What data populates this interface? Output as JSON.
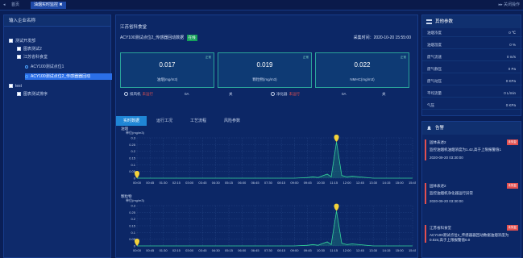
{
  "topbar": {
    "home_label": "首页",
    "active_tab": "油烟实时监控",
    "close_all": "关闭操作"
  },
  "tree": {
    "header": "输入企业名称",
    "nodes": [
      {
        "label": "测试开发部",
        "kind": "box",
        "level": 0
      },
      {
        "label": "图表测试2",
        "kind": "box",
        "level": 1
      },
      {
        "label": "江苏省科食堂",
        "kind": "box",
        "level": 1
      },
      {
        "label": "ACY100测试点位1",
        "kind": "dot",
        "level": 2
      },
      {
        "label": "ACY100测试点位2_传感器器回动",
        "kind": "dot",
        "level": 2,
        "selected": true
      },
      {
        "label": "test",
        "kind": "box",
        "level": 0
      },
      {
        "label": "图表测试排序",
        "kind": "box",
        "level": 1
      }
    ]
  },
  "main": {
    "restaurant": "江苏省科食堂",
    "device": "ACY100测试点位2_传感器回动数据",
    "online": "在线",
    "collect_time": "采集时间：2020-10-20 15:55:00",
    "cards": [
      {
        "value": "0.017",
        "label": "油烟(mg/m3)",
        "tag": "正常"
      },
      {
        "value": "0.019",
        "label": "颗粒物(mg/m3)",
        "tag": "正常"
      },
      {
        "value": "0.022",
        "label": "NMHC(mg/m3)",
        "tag": "正常"
      }
    ],
    "status": [
      {
        "name": "排风机",
        "state": "未运行",
        "current": "0A",
        "power": "关"
      },
      {
        "name": "净化器",
        "state": "未运行",
        "current": "0A",
        "power": "关"
      }
    ],
    "tabs": [
      "实时数据",
      "运行工况",
      "工艺流程",
      "风险参数"
    ]
  },
  "chart_data": [
    {
      "type": "line",
      "title": "油烟",
      "ylabel": "单位(mg/m3)",
      "ylim": [
        0,
        0.3
      ],
      "yticks": [
        "0.3",
        "0.25",
        "0.2",
        "0.15",
        "0.1",
        "0.05",
        "0"
      ],
      "x": [
        "00:00",
        "00:45",
        "01:30",
        "02:15",
        "03:00",
        "03:45",
        "04:30",
        "05:15",
        "06:00",
        "06:45",
        "07:30",
        "08:15",
        "09:00",
        "09:45",
        "10:30",
        "11:15",
        "12:00",
        "12:45",
        "13:30",
        "14:15",
        "15:00",
        "15:45"
      ],
      "values": [
        0,
        0,
        0,
        0,
        0,
        0,
        0,
        0,
        0,
        0,
        0,
        0,
        0,
        0.005,
        0.01,
        0.005,
        0.02,
        0.03,
        0.01,
        0.27,
        0.02,
        0.01,
        0.015,
        0,
        0,
        0
      ],
      "x_points": [
        0,
        1,
        2,
        3,
        4,
        5,
        6,
        7,
        8,
        9,
        10,
        11,
        12,
        13,
        13.4,
        13.8,
        14.2,
        14.5,
        14.8,
        15.2,
        15.6,
        16.0,
        16.4,
        18,
        20,
        21
      ]
    },
    {
      "type": "line",
      "title": "颗粒物",
      "ylabel": "单位(mg/m3)",
      "ylim": [
        0,
        0.3
      ],
      "yticks": [
        "0.3",
        "0.25",
        "0.2",
        "0.15",
        "0.1",
        "0.05",
        "0"
      ],
      "x": [
        "00:00",
        "00:45",
        "01:30",
        "02:15",
        "03:00",
        "03:45",
        "04:30",
        "05:15",
        "06:00",
        "06:45",
        "07:30",
        "08:15",
        "09:00",
        "09:45",
        "10:30",
        "11:15",
        "12:00",
        "12:45",
        "13:30",
        "14:15",
        "15:00",
        "15:45"
      ],
      "values": [
        0,
        0,
        0,
        0,
        0,
        0,
        0,
        0,
        0,
        0,
        0,
        0,
        0,
        0.005,
        0.01,
        0.005,
        0.02,
        0.03,
        0.01,
        0.26,
        0.02,
        0.01,
        0.015,
        0,
        0,
        0
      ],
      "x_points": [
        0,
        1,
        2,
        3,
        4,
        5,
        6,
        7,
        8,
        9,
        10,
        11,
        12,
        13,
        13.4,
        13.8,
        14.2,
        14.5,
        14.8,
        15.2,
        15.6,
        16.0,
        16.4,
        18,
        20,
        21
      ]
    }
  ],
  "params": {
    "title": "其他参数",
    "rows": [
      {
        "k": "油烟浓度",
        "v": "0 ℃"
      },
      {
        "k": "油烟湿度",
        "v": "0 %"
      },
      {
        "k": "废气流速",
        "v": "0 m/s"
      },
      {
        "k": "废气静压",
        "v": "0 Pa"
      },
      {
        "k": "废气动压",
        "v": "0 KPa"
      },
      {
        "k": "平均流量",
        "v": "0 L/min"
      },
      {
        "k": "气压",
        "v": "0 KPa"
      }
    ]
  },
  "alarms": {
    "title": "告警",
    "items": [
      {
        "title": "固体表述2",
        "tag": "未恢复",
        "msg": "监控油烟机油烟浓度为1.42,高于上限报警值1",
        "time": "2020-09-20 03:30:00"
      },
      {
        "title": "固体表述2",
        "tag": "未恢复",
        "msg": "监控油烟机净化器运行异常",
        "time": "2020-09-20 03:30:00"
      },
      {
        "title": "江苏省科食堂",
        "tag": "未恢复",
        "msg": "ACY100测试点位2_传感器器回动数据油烟浓度为 0.024,高于上限报警值0.0",
        "time": ""
      }
    ]
  }
}
